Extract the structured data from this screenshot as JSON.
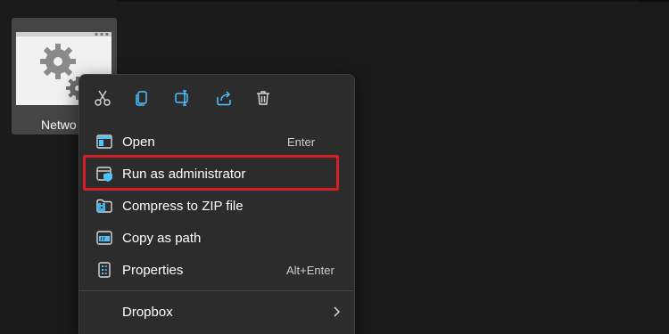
{
  "desktop": {
    "file_label": "Netwo"
  },
  "context_menu": {
    "quick_actions": [
      {
        "icon": "cut-icon",
        "tooltip": "Cut"
      },
      {
        "icon": "copy-icon",
        "tooltip": "Copy"
      },
      {
        "icon": "rename-icon",
        "tooltip": "Rename"
      },
      {
        "icon": "share-icon",
        "tooltip": "Share"
      },
      {
        "icon": "delete-icon",
        "tooltip": "Delete"
      }
    ],
    "items": [
      {
        "label": "Open",
        "shortcut": "Enter",
        "icon": "open-window-icon"
      },
      {
        "label": "Run as administrator",
        "shortcut": "",
        "icon": "shield-window-icon"
      },
      {
        "label": "Compress to ZIP file",
        "shortcut": "",
        "icon": "zip-folder-icon"
      },
      {
        "label": "Copy as path",
        "shortcut": "",
        "icon": "path-icon"
      },
      {
        "label": "Properties",
        "shortcut": "Alt+Enter",
        "icon": "properties-icon"
      },
      {
        "label": "Dropbox",
        "shortcut": "",
        "icon": "",
        "submenu": true
      }
    ]
  },
  "colors": {
    "menu_bg": "#2c2c2c",
    "accent_blue": "#4cc2ff",
    "highlight_red": "#d51f26"
  }
}
